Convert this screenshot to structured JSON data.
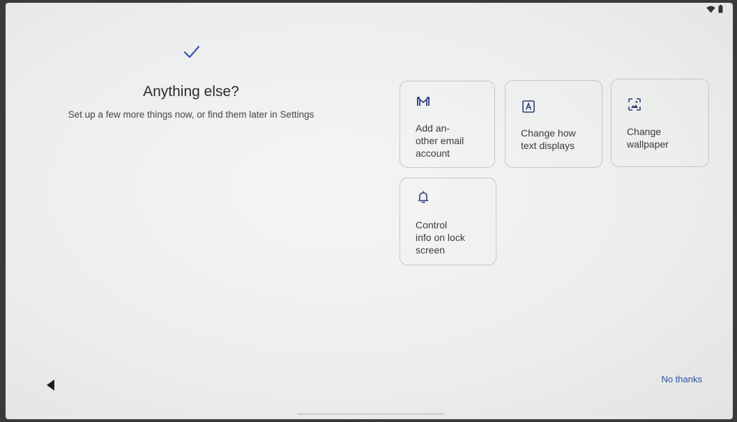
{
  "status_bar": {
    "icons": [
      "wifi-icon",
      "battery-icon"
    ]
  },
  "header": {
    "check_icon": "check-icon",
    "title": "Anything else?",
    "subtitle": "Set up a few more things now, or find them later in Settings"
  },
  "options": [
    {
      "icon": "gmail-icon",
      "label": "Add an-\nother email\naccount"
    },
    {
      "icon": "text-display-icon",
      "label": "Change how\ntext displays"
    },
    {
      "icon": "wallpaper-icon",
      "label": "Change\nwallpaper"
    },
    {
      "icon": "bell-icon",
      "label": "Control\ninfo on lock\nscreen"
    }
  ],
  "footer": {
    "back_icon": "back-arrow-icon",
    "no_thanks": "No thanks"
  },
  "colors": {
    "accent": "#2e4fa0",
    "icon": "#2f3b7a",
    "text": "#3a3a3a"
  }
}
